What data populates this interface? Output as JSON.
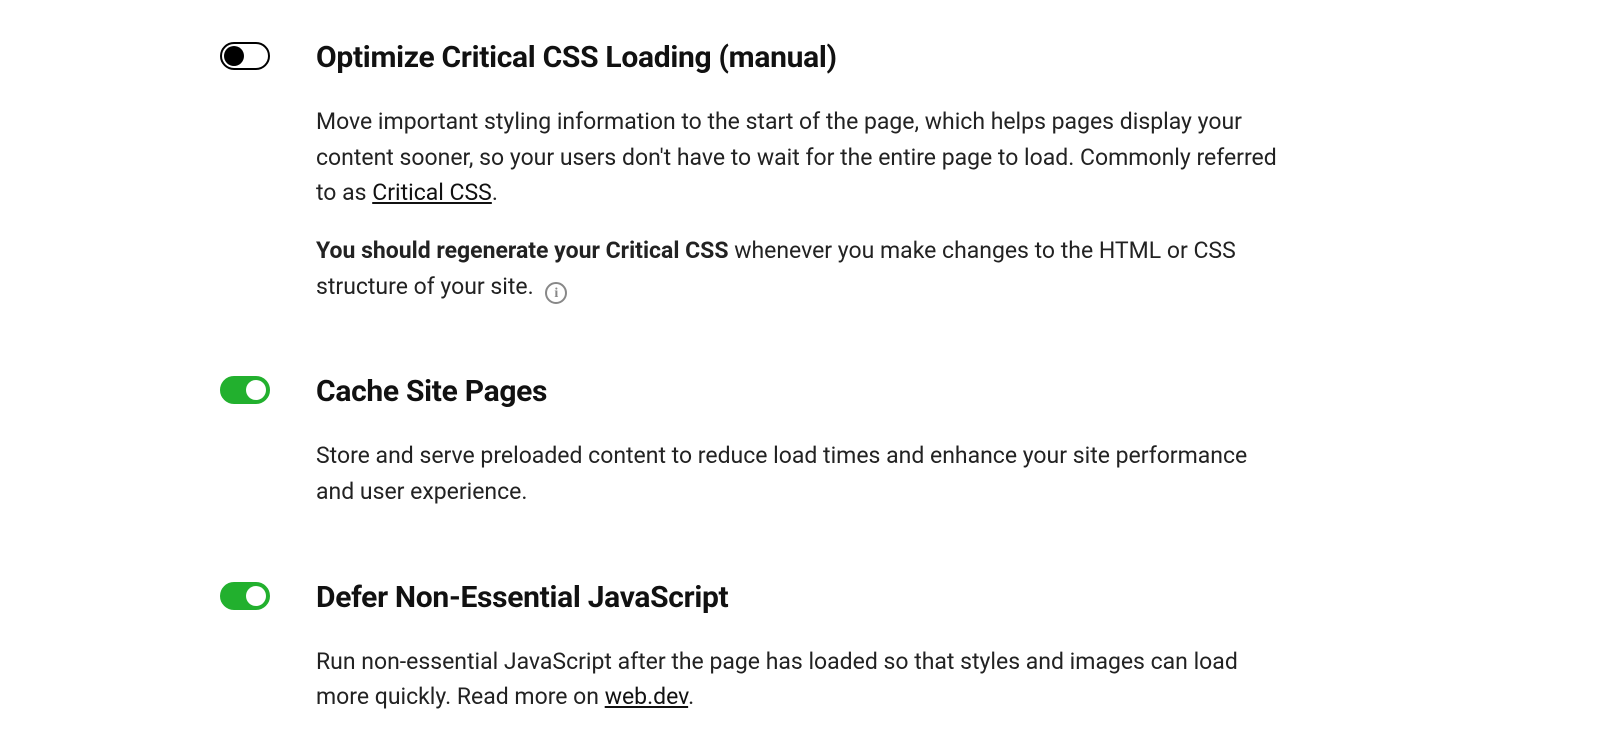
{
  "settings": [
    {
      "title": "Optimize Critical CSS Loading (manual)",
      "enabled": false,
      "desc1_pre": "Move important styling information to the start of the page, which helps pages display your content sooner, so your users don't have to wait for the entire page to load. Commonly referred to as ",
      "desc1_link": "Critical CSS",
      "desc1_post": ".",
      "desc2_bold": "You should regenerate your Critical CSS",
      "desc2_rest": " whenever you make changes to the HTML or CSS structure of your site. ",
      "has_info_icon": true
    },
    {
      "title": "Cache Site Pages",
      "enabled": true,
      "desc": "Store and serve preloaded content to reduce load times and enhance your site performance and user experience."
    },
    {
      "title": "Defer Non-Essential JavaScript",
      "enabled": true,
      "desc_pre": "Run non-essential JavaScript after the page has loaded so that styles and images can load more quickly. Read more on ",
      "desc_link": "web.dev",
      "desc_post": "."
    }
  ]
}
